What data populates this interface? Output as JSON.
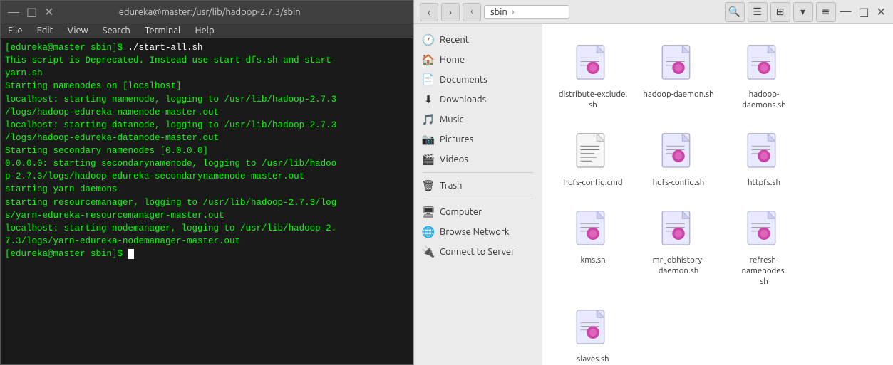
{
  "terminal": {
    "title": "edureka@master:/usr/lib/hadoop-2.7.3/sbin",
    "menu": [
      "File",
      "Edit",
      "View",
      "Search",
      "Terminal",
      "Help"
    ],
    "lines": [
      {
        "type": "prompt",
        "text": "[edureka@master sbin]$ ./start-all.sh"
      },
      {
        "type": "output",
        "text": "This script is Deprecated. Instead use start-dfs.sh and start-yarn.sh"
      },
      {
        "type": "output",
        "text": "Starting namenodes on [localhost]"
      },
      {
        "type": "output",
        "text": "localhost: starting namenode, logging to /usr/lib/hadoop-2.7.3/logs/hadoop-edureka-namenode-master.out"
      },
      {
        "type": "output",
        "text": "localhost: starting datanode, logging to /usr/lib/hadoop-2.7.3/logs/hadoop-edureka-datanode-master.out"
      },
      {
        "type": "output",
        "text": "Starting secondary namenodes [0.0.0.0]"
      },
      {
        "type": "output",
        "text": "0.0.0.0: starting secondarynamenode, logging to /usr/lib/hadoop-2.7.3/logs/hadoop-edureka-secondarynamenode-master.out"
      },
      {
        "type": "output",
        "text": "starting yarn daemons"
      },
      {
        "type": "output",
        "text": "starting resourcemanager, logging to /usr/lib/hadoop-2.7.3/logs/yarn-edureka-resourcemanager-master.out"
      },
      {
        "type": "output",
        "text": "localhost: starting nodemanager, logging to /usr/lib/hadoop-2.7.3/logs/yarn-edureka-nodemanager-master.out"
      },
      {
        "type": "prompt-end",
        "text": "[edureka@master sbin]$ "
      }
    ]
  },
  "filemanager": {
    "location": "sbin",
    "toolbar": {
      "search_icon": "🔍",
      "list_icon": "☰",
      "grid_icon": "⊞",
      "dropdown_icon": "▾",
      "menu_icon": "≡"
    },
    "sidebar": {
      "items": [
        {
          "id": "recent",
          "label": "Recent",
          "icon": "🕐"
        },
        {
          "id": "home",
          "label": "Home",
          "icon": "🏠"
        },
        {
          "id": "documents",
          "label": "Documents",
          "icon": "📄"
        },
        {
          "id": "downloads",
          "label": "Downloads",
          "icon": "⬇"
        },
        {
          "id": "music",
          "label": "Music",
          "icon": "🎵"
        },
        {
          "id": "pictures",
          "label": "Pictures",
          "icon": "📷"
        },
        {
          "id": "videos",
          "label": "Videos",
          "icon": "🎬"
        },
        {
          "id": "trash",
          "label": "Trash",
          "icon": "🗑"
        },
        {
          "id": "computer",
          "label": "Computer",
          "icon": "🖥"
        },
        {
          "id": "browse-network",
          "label": "Browse Network",
          "icon": "🌐"
        },
        {
          "id": "connect-to-server",
          "label": "Connect to Server",
          "icon": "🔌"
        }
      ]
    },
    "files": [
      {
        "name": "distribute-exclude.\nsh",
        "type": "script"
      },
      {
        "name": "hadoop-daemon.sh",
        "type": "script"
      },
      {
        "name": "hadoop-daemons.sh",
        "type": "script"
      },
      {
        "name": "hdfs-config.cmd",
        "type": "cmd"
      },
      {
        "name": "hdfs-config.sh",
        "type": "script"
      },
      {
        "name": "httpfs.sh",
        "type": "script"
      },
      {
        "name": "kms.sh",
        "type": "script"
      },
      {
        "name": "mr-jobhistory-\ndaemon.sh",
        "type": "script"
      },
      {
        "name": "refresh-namenodes.\nsh",
        "type": "script"
      },
      {
        "name": "slaves.sh",
        "type": "script"
      }
    ]
  }
}
